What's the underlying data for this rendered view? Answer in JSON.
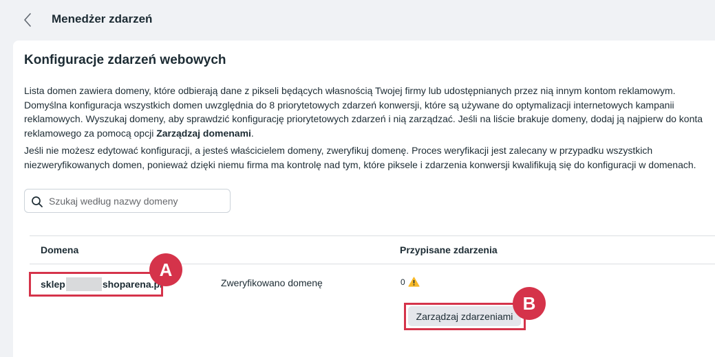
{
  "header": {
    "title": "Menedżer zdarzeń"
  },
  "card": {
    "title": "Konfiguracje zdarzeń webowych",
    "desc1_pre": "Lista domen zawiera domeny, które odbierają dane z pikseli będących własnością Twojej firmy lub udostępnianych przez nią innym kontom reklamowym. Domyślna konfiguracja wszystkich domen uwzględnia do 8 priorytetowych zdarzeń konwersji, które są używane do optymalizacji internetowych kampanii reklamowych. Wyszukaj domeny, aby sprawdzić konfigurację priorytetowych zdarzeń i nią zarządzać. Jeśli na liście brakuje domeny, dodaj ją najpierw do konta reklamowego za pomocą opcji ",
    "desc1_bold": "Zarządzaj domenami",
    "desc1_post": ".",
    "desc2": "Jeśli nie możesz edytować konfiguracji, a jesteś właścicielem domeny, zweryfikuj domenę. Proces weryfikacji jest zalecany w przypadku wszystkich niezweryfikowanych domen, ponieważ dzięki niemu firma ma kontrolę nad tym, które piksele i zdarzenia konwersji kwalifikują się do konfiguracji w domenach."
  },
  "search": {
    "placeholder": "Szukaj według nazwy domeny",
    "icon": "search-icon"
  },
  "table": {
    "headers": {
      "domain": "Domena",
      "events": "Przypisane zdarzenia"
    },
    "rows": [
      {
        "domain_prefix": "sklep",
        "domain_suffix": "shoparena.pl",
        "status": "Zweryfikowano domenę",
        "events_count": "0",
        "warning_icon": "warning-icon",
        "manage_label": "Zarządzaj zdarzeniami"
      }
    ]
  },
  "annotations": {
    "a": "A",
    "b": "B",
    "color": "#d5334a"
  }
}
